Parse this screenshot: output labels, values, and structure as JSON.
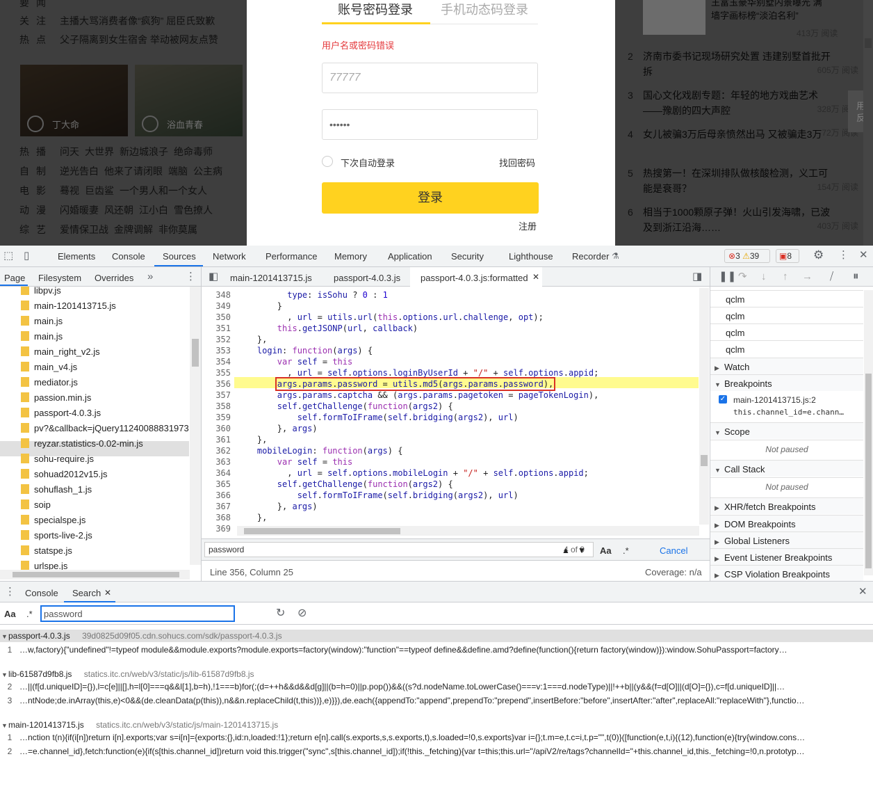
{
  "page": {
    "left_rows": [
      {
        "cat": "关注",
        "items": [
          "主播大骂消费者像“疯狗” 屈臣氏致歉"
        ]
      },
      {
        "cat": "热点",
        "items": [
          "父子隔离到女生宿舍 举动被网友点赞"
        ]
      }
    ],
    "thumbs": [
      {
        "caption": "丁大命"
      },
      {
        "caption": "浴血青春"
      }
    ],
    "left_links": [
      {
        "cat": "热播",
        "items": [
          "问天",
          "大世界",
          "新边城浪子",
          "绝命毒师"
        ]
      },
      {
        "cat": "自制",
        "items": [
          "逆光告白",
          "他来了请闭眼",
          "端脑",
          "公主病"
        ]
      },
      {
        "cat": "电影",
        "items": [
          "蓦视",
          "巨齿鲨",
          "一个男人和一个女人"
        ]
      },
      {
        "cat": "动漫",
        "items": [
          "闪婚暖妻",
          "风还朝",
          "江小白",
          "雪色撩人"
        ]
      },
      {
        "cat": "综艺",
        "items": [
          "爱情保卫战",
          "金牌调解",
          "非你莫属"
        ]
      }
    ],
    "login": {
      "tab_password": "账号密码登录",
      "tab_phone": "手机动态码登录",
      "error": "用户名或密码错误",
      "username": "77777",
      "password": "••••••",
      "auto_login": "下次自动登录",
      "forgot": "找回密码",
      "submit": "登录",
      "register": "注册"
    },
    "news_top": "王富玉豪华别墅内景曝光 满墙字画标榜“淡泊名利”",
    "news_top_reads": "413万 阅读",
    "news": [
      {
        "num": "2",
        "text": "济南市委书记现场研究处置 违建别墅首批开拆",
        "reads": "605万 阅读"
      },
      {
        "num": "3",
        "text": "国心文化戏剧专题：年轻的地方戏曲艺术——豫剧的四大声腔",
        "reads": "328万 阅读"
      },
      {
        "num": "4",
        "text": "女儿被骗3万后母亲愤然出马 又被骗走3万",
        "reads": "72万 阅读"
      },
      {
        "num": "5",
        "text": "热搜第一！在深圳排队做核酸检测，义工可能是衰哥？",
        "reads": "154万 阅读"
      },
      {
        "num": "6",
        "text": "相当于1000颗原子弹！火山引发海啸，已波及到浙江沿海……",
        "reads": "403万 阅读"
      }
    ],
    "side_float": "用 反"
  },
  "devtools": {
    "tabs": [
      "Elements",
      "Console",
      "Sources",
      "Network",
      "Performance",
      "Memory",
      "Application",
      "Security",
      "Lighthouse",
      "Recorder"
    ],
    "active_tab": "Sources",
    "errors": "3",
    "warnings": "39",
    "issues": "8",
    "nav_tabs": [
      "Page",
      "Filesystem",
      "Overrides"
    ],
    "files": [
      "libpv.js",
      "main-1201413715.js",
      "main.js",
      "main.js",
      "main_right_v2.js",
      "main_v4.js",
      "mediator.js",
      "passion.min.js",
      "passport-4.0.3.js",
      "pv?&callback=jQuery11240088831973",
      "reyzar.statistics-0.02-min.js",
      "sohu-require.js",
      "sohuad2012v15.js",
      "sohuflash_1.js",
      "soip",
      "specialspe.js",
      "sports-live-2.js",
      "statspe.js",
      "urlspe.js"
    ],
    "selected_file": "passport-4.0.3.js",
    "editor_tabs": [
      "main-1201413715.js",
      "passport-4.0.3.js",
      "passport-4.0.3.js:formatted"
    ],
    "line_numbers": [
      "348",
      "349",
      "350",
      "351",
      "352",
      "353",
      "354",
      "355",
      "356",
      "357",
      "358",
      "359",
      "360",
      "361",
      "362",
      "363",
      "364",
      "365",
      "366",
      "367",
      "368",
      "369"
    ],
    "search_query": "password",
    "match_count": "4 of 9",
    "aa": "Aa",
    "regex": ".*",
    "cancel": "Cancel",
    "status": "Line 356, Column 25",
    "coverage": "Coverage: n/a",
    "watch_items": [
      "qclm",
      "qclm",
      "qclm",
      "qclm"
    ],
    "sections": [
      "Watch",
      "Breakpoints",
      "Scope",
      "Call Stack",
      "XHR/fetch Breakpoints",
      "DOM Breakpoints",
      "Global Listeners",
      "Event Listener Breakpoints",
      "CSP Violation Breakpoints"
    ],
    "breakpoint_file": "main-1201413715.js:2",
    "breakpoint_code": "this.channel_id=e.chann…",
    "not_paused": "Not paused",
    "drawer_tabs": [
      "Console",
      "Search"
    ],
    "drawer_search": "password",
    "results": [
      {
        "file": "passport-4.0.3.js",
        "url": "39d0825d09f05.cdn.sohucs.com/sdk/passport-4.0.3.js",
        "lines": [
          {
            "n": "1",
            "t": "…w,factory){\"undefined\"!=typeof module&&module.exports?module.exports=factory(window):\"function\"==typeof define&&define.amd?define(function(){return factory(window)}):window.SohuPassport=factory…"
          }
        ]
      },
      {
        "file": "lib-61587d9fb8.js",
        "url": "statics.itc.cn/web/v3/static/js/lib-61587d9fb8.js",
        "lines": [
          {
            "n": "2",
            "t": "…||(f[d.uniqueID]={}),l=c[e]||[],h=l[0]===q&&l[1],b=h),!1===b)for(;(d=++h&&d&&d[g]||(b=h=0)||p.pop())&&((s?d.nodeName.toLowerCase()===v:1===d.nodeType)||!++b||(y&&(f=d[O]||(d[O]={}),c=f[d.uniqueID]||…"
          },
          {
            "n": "3",
            "t": "…ntNode;de.inArray(this,e)<0&&(de.cleanData(p(this)),n&&n.replaceChild(t,this))},e)}}),de.each({appendTo:\"append\",prependTo:\"prepend\",insertBefore:\"before\",insertAfter:\"after\",replaceAll:\"replaceWith\"},functio…"
          }
        ]
      },
      {
        "file": "main-1201413715.js",
        "url": "statics.itc.cn/web/v3/static/js/main-1201413715.js",
        "lines": [
          {
            "n": "1",
            "t": "…nction t(n){if(i[n])return i[n].exports;var s=i[n]={exports:{},id:n,loaded:!1};return e[n].call(s.exports,s,s.exports,t),s.loaded=!0,s.exports}var i={};t.m=e,t.c=i,t.p=\"\",t(0)}([function(e,t,i){(12),function(e){try{window.cons…"
          },
          {
            "n": "2",
            "t": "…=e.channel_id},fetch:function(e){if(s[this.channel_id])return void this.trigger(\"sync\",s[this.channel_id]);if(!this._fetching){var t=this;this.url=\"/apiV2/re/tags?channelId=\"+this.channel_id,this._fetching=!0,n.prototyp…"
          }
        ]
      }
    ]
  }
}
